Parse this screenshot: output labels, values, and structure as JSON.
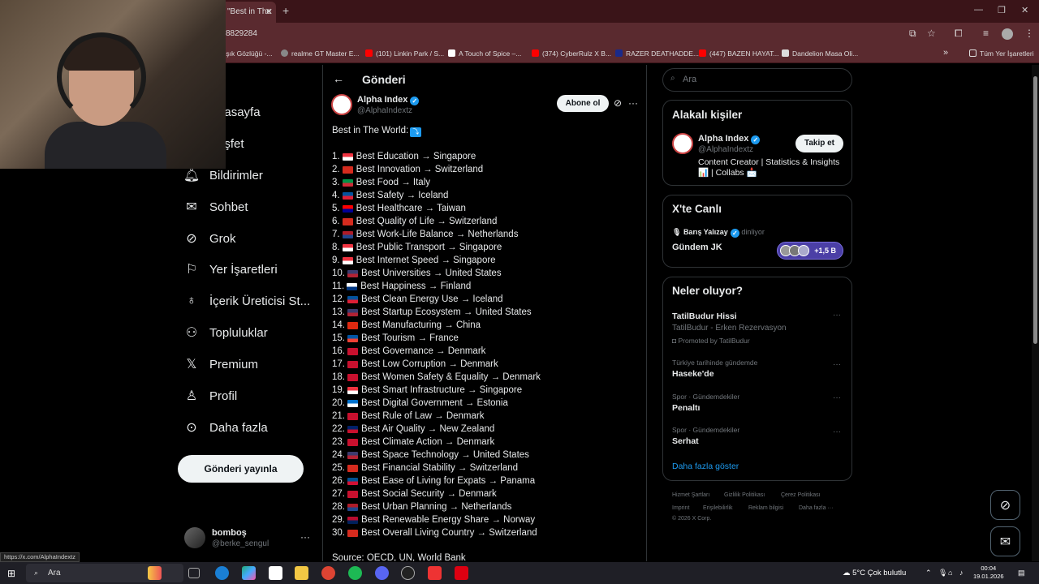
{
  "browser": {
    "tab_title": "\"Best in The",
    "new_tab": "+",
    "tab_close": "✕",
    "url": "8829284",
    "bookmarks": [
      "Işık Gözlüğü -...",
      "realme GT Master E...",
      "(101) Linkin Park / S...",
      "A Touch of Spice –...",
      "(374) CyberRulz X B...",
      "RAZER DEATHADDE...",
      "(447) BAZEN HAYAT...",
      "Dandelion Masa Oli..."
    ],
    "bookmarks_overflow": "»",
    "all_bookmarks": "Tüm Yer İşaretleri",
    "status_url": "https://x.com/AlphaIndextz"
  },
  "nav": {
    "items": [
      {
        "label": "Anasayfa",
        "icon": "home-icon"
      },
      {
        "label": "Keşfet",
        "icon": "explore-icon"
      },
      {
        "label": "Bildirimler",
        "icon": "bell-icon"
      },
      {
        "label": "Sohbet",
        "icon": "mail-icon"
      },
      {
        "label": "Grok",
        "icon": "grok-icon"
      },
      {
        "label": "Yer İşaretleri",
        "icon": "bookmark-icon"
      },
      {
        "label": "İçerik Üreticisi St...",
        "icon": "creator-icon"
      },
      {
        "label": "Topluluklar",
        "icon": "communities-icon"
      },
      {
        "label": "Premium",
        "icon": "x-logo-icon"
      },
      {
        "label": "Profil",
        "icon": "person-icon"
      },
      {
        "label": "Daha fazla",
        "icon": "more-circle-icon"
      }
    ],
    "post_button": "Gönderi yayınla",
    "account_name": "bomboş",
    "account_handle": "@berke_sengul",
    "account_more": "···"
  },
  "post": {
    "header_title": "Gönderi",
    "author_name": "Alpha Index",
    "author_handle": "@AlphaIndextz",
    "subscribe": "Abone ol",
    "more": "···",
    "intro": "Best in The World:",
    "intro_emoji": "⤵",
    "items": [
      {
        "n": "1.",
        "text": "Best Education → Singapore",
        "flag": [
          "#ef3340",
          "#ffffff"
        ]
      },
      {
        "n": "2.",
        "text": "Best Innovation → Switzerland",
        "flag": [
          "#d52b1e",
          "#d52b1e"
        ]
      },
      {
        "n": "3.",
        "text": "Best Food → Italy",
        "flag": [
          "#009246",
          "#ce2b37"
        ]
      },
      {
        "n": "4.",
        "text": "Best Safety → Iceland",
        "flag": [
          "#02529c",
          "#dc1e35"
        ]
      },
      {
        "n": "5.",
        "text": "Best Healthcare → Taiwan",
        "flag": [
          "#fe0000",
          "#000095"
        ]
      },
      {
        "n": "6.",
        "text": "Best Quality of Life → Switzerland",
        "flag": [
          "#d52b1e",
          "#d52b1e"
        ]
      },
      {
        "n": "7.",
        "text": "Best Work-Life Balance → Netherlands",
        "flag": [
          "#ae1c28",
          "#21468b"
        ]
      },
      {
        "n": "8.",
        "text": "Best Public Transport → Singapore",
        "flag": [
          "#ef3340",
          "#ffffff"
        ]
      },
      {
        "n": "9.",
        "text": "Best Internet Speed → Singapore",
        "flag": [
          "#ef3340",
          "#ffffff"
        ]
      },
      {
        "n": "10.",
        "text": "Best Universities → United States",
        "flag": [
          "#3c3b6e",
          "#b22234"
        ]
      },
      {
        "n": "11.",
        "text": "Best Happiness → Finland",
        "flag": [
          "#ffffff",
          "#003580"
        ]
      },
      {
        "n": "12.",
        "text": "Best Clean Energy Use → Iceland",
        "flag": [
          "#02529c",
          "#dc1e35"
        ]
      },
      {
        "n": "13.",
        "text": "Best Startup Ecosystem → United States",
        "flag": [
          "#3c3b6e",
          "#b22234"
        ]
      },
      {
        "n": "14.",
        "text": "Best Manufacturing → China",
        "flag": [
          "#de2910",
          "#de2910"
        ]
      },
      {
        "n": "15.",
        "text": "Best Tourism → France",
        "flag": [
          "#0055a4",
          "#ef4135"
        ]
      },
      {
        "n": "16.",
        "text": "Best Governance → Denmark",
        "flag": [
          "#c8102e",
          "#c8102e"
        ]
      },
      {
        "n": "17.",
        "text": "Best Low Corruption → Denmark",
        "flag": [
          "#c8102e",
          "#c8102e"
        ]
      },
      {
        "n": "18.",
        "text": "Best Women Safety & Equality → Denmark",
        "flag": [
          "#c8102e",
          "#c8102e"
        ]
      },
      {
        "n": "19.",
        "text": "Best Smart Infrastructure → Singapore",
        "flag": [
          "#ef3340",
          "#ffffff"
        ]
      },
      {
        "n": "20.",
        "text": "Best Digital Government → Estonia",
        "flag": [
          "#0072ce",
          "#ffffff"
        ]
      },
      {
        "n": "21.",
        "text": "Best Rule of Law → Denmark",
        "flag": [
          "#c8102e",
          "#c8102e"
        ]
      },
      {
        "n": "22.",
        "text": "Best Air Quality → New Zealand",
        "flag": [
          "#012169",
          "#c8102e"
        ]
      },
      {
        "n": "23.",
        "text": "Best Climate Action → Denmark",
        "flag": [
          "#c8102e",
          "#c8102e"
        ]
      },
      {
        "n": "24.",
        "text": "Best Space Technology → United States",
        "flag": [
          "#3c3b6e",
          "#b22234"
        ]
      },
      {
        "n": "25.",
        "text": "Best Financial Stability → Switzerland",
        "flag": [
          "#d52b1e",
          "#d52b1e"
        ]
      },
      {
        "n": "26.",
        "text": "Best Ease of Living for Expats → Panama",
        "flag": [
          "#005293",
          "#d21034"
        ]
      },
      {
        "n": "27.",
        "text": "Best Social Security → Denmark",
        "flag": [
          "#c8102e",
          "#c8102e"
        ]
      },
      {
        "n": "28.",
        "text": "Best Urban Planning → Netherlands",
        "flag": [
          "#ae1c28",
          "#21468b"
        ]
      },
      {
        "n": "29.",
        "text": "Best Renewable Energy Share → Norway",
        "flag": [
          "#ba0c2f",
          "#00205b"
        ]
      },
      {
        "n": "30.",
        "text": "Best Overall Living Country → Switzerland",
        "flag": [
          "#d52b1e",
          "#d52b1e"
        ]
      }
    ],
    "source": "Source: OECD, UN, World Bank"
  },
  "right": {
    "search_placeholder": "Ara",
    "related_title": "Alakalı kişiler",
    "related_name": "Alpha Index",
    "related_handle": "@AlphaIndextz",
    "follow_button": "Takip et",
    "related_bio": "Content Creator | Statistics & Insights 📊 | Collabs 📩",
    "live_title": "X'te Canlı",
    "live_host": "Barış Yalızay",
    "live_state": "dinliyor",
    "live_topic": "Gündem JK",
    "live_count": "+1,5 B",
    "trends_title": "Neler oluyor?",
    "trends": [
      {
        "context": "",
        "title": "TatilBudur Hissi",
        "sub": "TatilBudur - Erken Rezervasyon",
        "promo": "Promoted by TatilBudur"
      },
      {
        "context": "Türkiye tarihinde gündemde",
        "title": "Haseke'de",
        "sub": "",
        "promo": ""
      },
      {
        "context": "Spor · Gündemdekiler",
        "title": "Penaltı",
        "sub": "",
        "promo": ""
      },
      {
        "context": "Spor · Gündemdekiler",
        "title": "Serhat",
        "sub": "",
        "promo": ""
      }
    ],
    "trend_more": "···",
    "show_more": "Daha fazla göster",
    "footer": [
      "Hizmet Şartları",
      "Gizlilik Politikası",
      "Çerez Politikası",
      "Imprint",
      "Erişilebilirlik",
      "Reklam bilgisi",
      "Daha fazla ···",
      "© 2026 X Corp."
    ]
  },
  "taskbar": {
    "search_placeholder": "Ara",
    "weather": "5°C  Çok bulutlu",
    "time": "00:04",
    "date": "19.01.2026"
  },
  "colors": {
    "accent": "#1d9bf0",
    "browser_frame": "#5a2a2f",
    "border": "#2f3336"
  }
}
